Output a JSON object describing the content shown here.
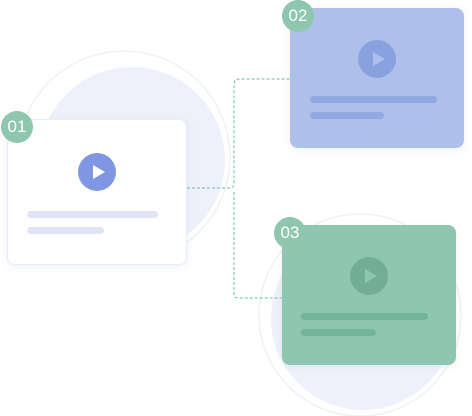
{
  "colors": {
    "accent_blue": "#7f97e3",
    "card_blue": "#aec0ea",
    "card_green": "#8ec6b1",
    "badge_green": "#8ec6ae",
    "connector": "#6fbd99",
    "backdrop": "#eef1fb"
  },
  "steps": [
    {
      "number": "01",
      "icon": "play-icon"
    },
    {
      "number": "02",
      "icon": "play-icon"
    },
    {
      "number": "03",
      "icon": "play-icon"
    }
  ]
}
